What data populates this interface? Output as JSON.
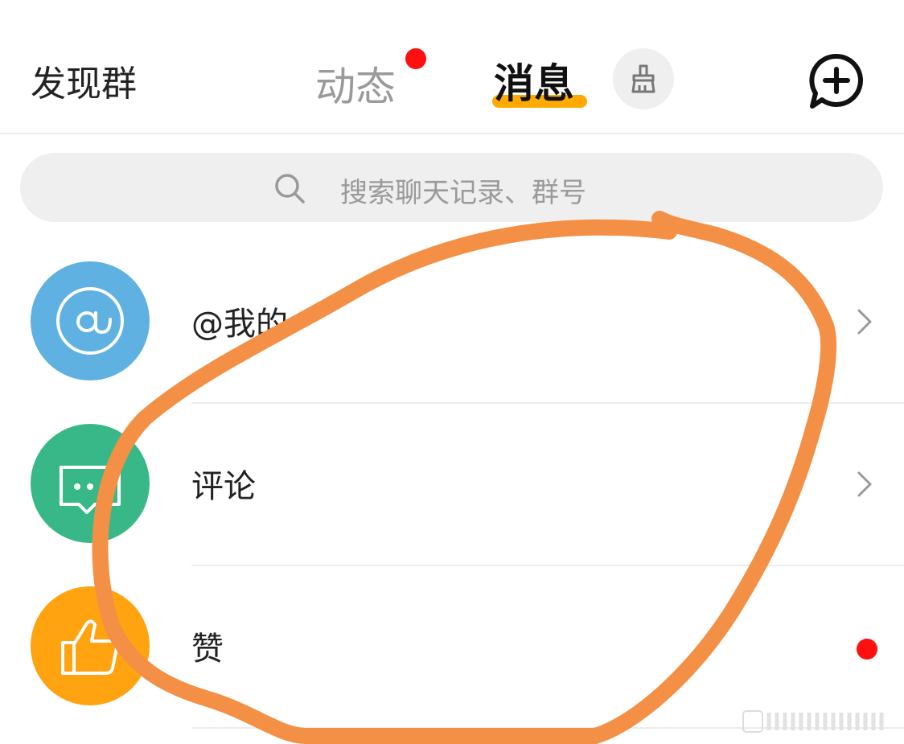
{
  "header": {
    "discover_label": "发现群",
    "tabs": [
      {
        "label": "动态",
        "active": false,
        "has_dot": true
      },
      {
        "label": "消息",
        "active": true
      }
    ],
    "clean_icon": "broom-icon",
    "new_chat_icon": "chat-plus-icon"
  },
  "search": {
    "placeholder": "搜索聊天记录、群号",
    "icon": "search-icon"
  },
  "list": [
    {
      "label": "@我的",
      "icon": "at-icon",
      "icon_bg": "#5eb1e0",
      "trailing": "chevron"
    },
    {
      "label": "评论",
      "icon": "comment-icon",
      "icon_bg": "#38b889",
      "trailing": "chevron"
    },
    {
      "label": "赞",
      "icon": "thumbs-up-icon",
      "icon_bg": "#ffa310",
      "trailing": "red-dot"
    }
  ],
  "colors": {
    "accent": "#ffaa00",
    "badge": "#ff1010",
    "annotation_stroke": "#f39046"
  }
}
